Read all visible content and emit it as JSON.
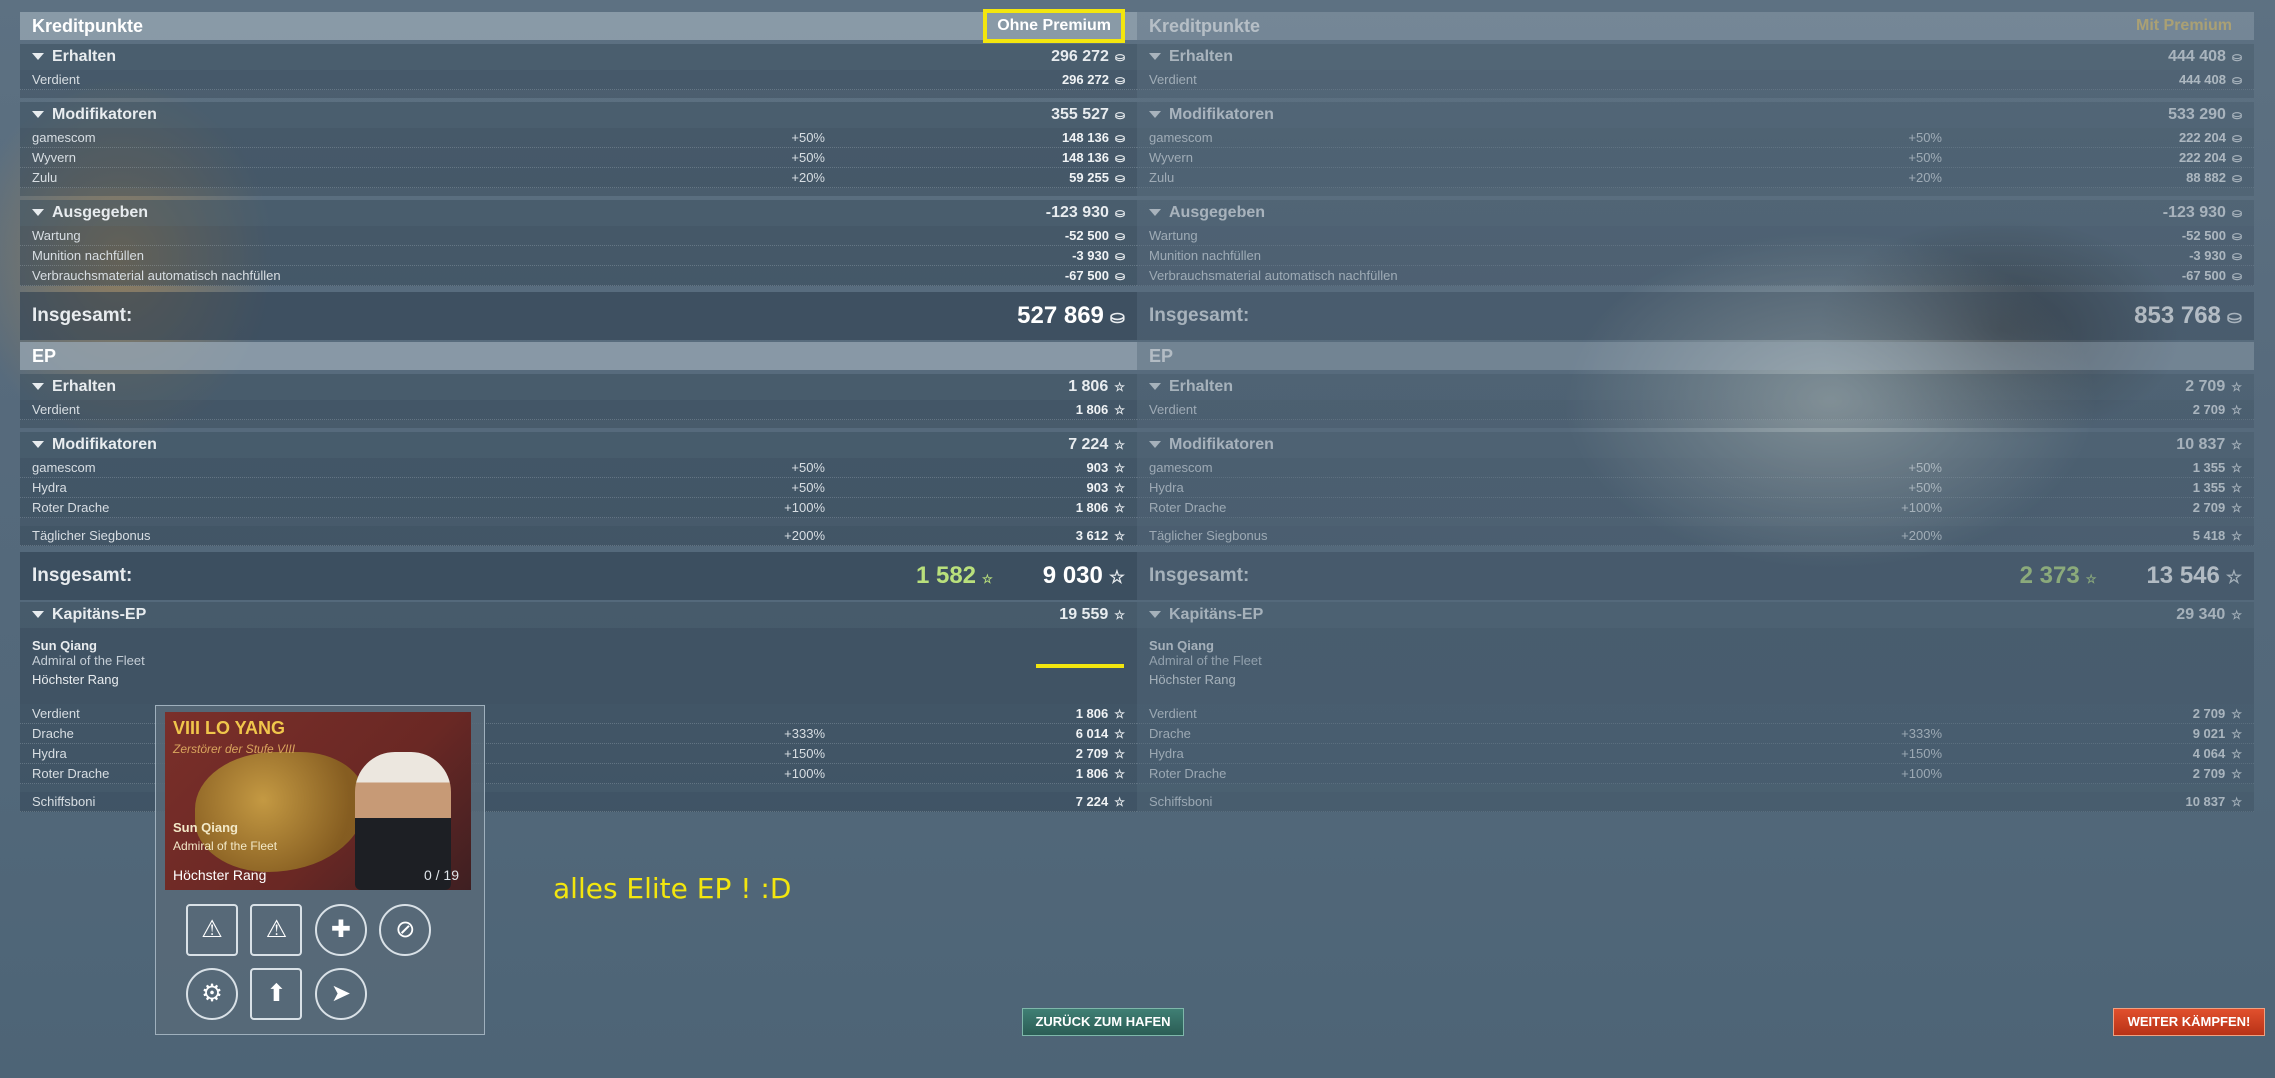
{
  "left": {
    "credits": {
      "title": "Kreditpunkte",
      "premium_label": "Ohne Premium",
      "earned": {
        "label": "Erhalten",
        "value": "296 272",
        "rows": [
          {
            "label": "Verdient",
            "value": "296 272"
          }
        ]
      },
      "modifiers": {
        "label": "Modifikatoren",
        "value": "355 527",
        "rows": [
          {
            "label": "gamescom",
            "mod": "+50%",
            "value": "148 136"
          },
          {
            "label": "Wyvern",
            "mod": "+50%",
            "value": "148 136"
          },
          {
            "label": "Zulu",
            "mod": "+20%",
            "value": "59 255"
          }
        ]
      },
      "spent": {
        "label": "Ausgegeben",
        "value": "-123 930",
        "rows": [
          {
            "label": "Wartung",
            "value": "-52 500"
          },
          {
            "label": "Munition nachfüllen",
            "value": "-3 930"
          },
          {
            "label": "Verbrauchsmaterial automatisch nachfüllen",
            "value": "-67 500"
          }
        ]
      },
      "total_label": "Insgesamt:",
      "total": "527 869"
    },
    "xp": {
      "title": "EP",
      "earned": {
        "label": "Erhalten",
        "value": "1 806",
        "rows": [
          {
            "label": "Verdient",
            "value": "1 806"
          }
        ]
      },
      "modifiers": {
        "label": "Modifikatoren",
        "value": "7 224",
        "rows": [
          {
            "label": "gamescom",
            "mod": "+50%",
            "value": "903"
          },
          {
            "label": "Hydra",
            "mod": "+50%",
            "value": "903"
          },
          {
            "label": "Roter Drache",
            "mod": "+100%",
            "value": "1 806"
          }
        ]
      },
      "daily": {
        "label": "Täglicher Siegbonus",
        "mod": "+200%",
        "value": "3 612"
      },
      "total_label": "Insgesamt:",
      "free": "1 582",
      "total": "9 030"
    },
    "captain": {
      "label": "Kapitäns-EP",
      "value": "19 559",
      "name": "Sun Qiang",
      "rank": "Admiral of the Fleet",
      "highest": "Höchster Rang",
      "rows": [
        {
          "label": "Verdient",
          "mod": "",
          "value": "1 806"
        },
        {
          "label": "Drache",
          "mod": "+333%",
          "value": "6 014"
        },
        {
          "label": "Hydra",
          "mod": "+150%",
          "value": "2 709"
        },
        {
          "label": "Roter Drache",
          "mod": "+100%",
          "value": "1 806"
        }
      ],
      "ship_bonus": {
        "label": "Schiffsboni",
        "value": "7 224"
      }
    }
  },
  "right": {
    "credits": {
      "title": "Kreditpunkte",
      "premium_label": "Mit Premium",
      "earned": {
        "label": "Erhalten",
        "value": "444 408",
        "rows": [
          {
            "label": "Verdient",
            "value": "444 408"
          }
        ]
      },
      "modifiers": {
        "label": "Modifikatoren",
        "value": "533 290",
        "rows": [
          {
            "label": "gamescom",
            "mod": "+50%",
            "value": "222 204"
          },
          {
            "label": "Wyvern",
            "mod": "+50%",
            "value": "222 204"
          },
          {
            "label": "Zulu",
            "mod": "+20%",
            "value": "88 882"
          }
        ]
      },
      "spent": {
        "label": "Ausgegeben",
        "value": "-123 930",
        "rows": [
          {
            "label": "Wartung",
            "value": "-52 500"
          },
          {
            "label": "Munition nachfüllen",
            "value": "-3 930"
          },
          {
            "label": "Verbrauchsmaterial automatisch nachfüllen",
            "value": "-67 500"
          }
        ]
      },
      "total_label": "Insgesamt:",
      "total": "853 768"
    },
    "xp": {
      "title": "EP",
      "earned": {
        "label": "Erhalten",
        "value": "2 709",
        "rows": [
          {
            "label": "Verdient",
            "value": "2 709"
          }
        ]
      },
      "modifiers": {
        "label": "Modifikatoren",
        "value": "10 837",
        "rows": [
          {
            "label": "gamescom",
            "mod": "+50%",
            "value": "1 355"
          },
          {
            "label": "Hydra",
            "mod": "+50%",
            "value": "1 355"
          },
          {
            "label": "Roter Drache",
            "mod": "+100%",
            "value": "2 709"
          }
        ]
      },
      "daily": {
        "label": "Täglicher Siegbonus",
        "mod": "+200%",
        "value": "5 418"
      },
      "total_label": "Insgesamt:",
      "free": "2 373",
      "total": "13 546"
    },
    "captain": {
      "label": "Kapitäns-EP",
      "value": "29 340",
      "name": "Sun Qiang",
      "rank": "Admiral of the Fleet",
      "highest": "Höchster Rang",
      "rows": [
        {
          "label": "Verdient",
          "mod": "",
          "value": "2 709"
        },
        {
          "label": "Drache",
          "mod": "+333%",
          "value": "9 021"
        },
        {
          "label": "Hydra",
          "mod": "+150%",
          "value": "4 064"
        },
        {
          "label": "Roter Drache",
          "mod": "+100%",
          "value": "2 709"
        }
      ],
      "ship_bonus": {
        "label": "Schiffsboni",
        "value": "10 837"
      }
    }
  },
  "card": {
    "tier_title": "VIII LO YANG",
    "subtitle": "Zerstörer der Stufe VIII",
    "name": "Sun Qiang",
    "rank": "Admiral of the Fleet",
    "highest": "Höchster Rang",
    "points": "0 / 19",
    "skills": [
      "torpedo-reload-warning-icon",
      "incoming-fire-alert-icon",
      "repair-heal-icon",
      "no-fire-icon",
      "engine-boost-icon",
      "concealment-icon",
      "radio-location-icon"
    ]
  },
  "annotation": "alles Elite EP ! :D",
  "buttons": {
    "back": "ZURÜCK ZUM HAFEN",
    "fight": "WEITER KÄMPFEN!"
  },
  "icons": {
    "credit": "credit-coin-icon",
    "xp": "star-outline-icon"
  },
  "colors": {
    "highlight": "#f3e60e",
    "free_xp": "#b9e07c",
    "premium_gold": "#e9c86a",
    "fight_button": "#d0401f",
    "back_button": "#2f6a61"
  }
}
